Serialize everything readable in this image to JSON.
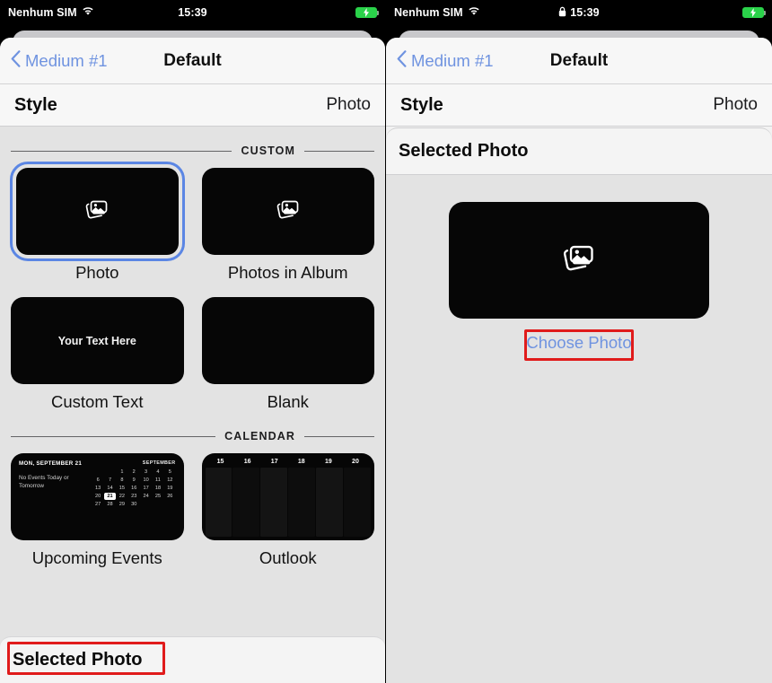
{
  "left_phone": {
    "status_bar": {
      "carrier": "Nenhum SIM",
      "wifi_icon": "wifi-icon",
      "time": "15:39",
      "battery_icon": "battery-charging-icon"
    },
    "nav": {
      "back_icon": "chevron-left-icon",
      "back_label": "Medium #1",
      "title": "Default"
    },
    "style_row": {
      "label": "Style",
      "value": "Photo"
    },
    "sections": [
      {
        "caption": "CUSTOM",
        "tiles": [
          {
            "label": "Photo",
            "icon": "photo-stack-icon",
            "selected": true
          },
          {
            "label": "Photos in Album",
            "icon": "photo-stack-icon",
            "selected": false
          },
          {
            "label": "Custom Text",
            "preview_text": "Your Text Here",
            "selected": false
          },
          {
            "label": "Blank",
            "selected": false
          }
        ]
      },
      {
        "caption": "CALENDAR",
        "tiles": [
          {
            "label": "Upcoming Events",
            "widget": "calendar"
          },
          {
            "label": "Outlook",
            "widget": "outlook"
          }
        ]
      }
    ],
    "calendar_widget": {
      "title": "MON, SEPTEMBER 21",
      "subtitle": "No Events Today or Tomorrow",
      "month": "SEPTEMBER",
      "days": [
        "",
        "",
        "1",
        "2",
        "3",
        "4",
        "5",
        "6",
        "7",
        "8",
        "9",
        "10",
        "11",
        "12",
        "13",
        "14",
        "15",
        "16",
        "17",
        "18",
        "19",
        "20",
        "21",
        "22",
        "23",
        "24",
        "25",
        "26",
        "27",
        "28",
        "29",
        "30"
      ],
      "today": "21"
    },
    "outlook_widget": {
      "columns": [
        "15",
        "16",
        "17",
        "18",
        "19",
        "20"
      ]
    },
    "bottom_sheet": {
      "title": "Selected Photo"
    }
  },
  "right_phone": {
    "status_bar": {
      "carrier": "Nenhum SIM",
      "wifi_icon": "wifi-icon",
      "lock_icon": "lock-icon",
      "time": "15:39",
      "battery_icon": "battery-charging-icon"
    },
    "nav": {
      "back_icon": "chevron-left-icon",
      "back_label": "Medium #1",
      "title": "Default"
    },
    "style_row": {
      "label": "Style",
      "value": "Photo"
    },
    "selected_photo_panel": {
      "title": "Selected Photo",
      "preview_icon": "photo-stack-icon",
      "choose_label": "Choose Photo"
    }
  },
  "annotations": {
    "highlight_color": "#e01b1b",
    "boxes": [
      "Selected Photo",
      "Choose Photo"
    ]
  },
  "colors": {
    "accent_blue": "#6f93e0",
    "selection_blue": "#5b86e4",
    "annotation_red": "#e01b1b",
    "sheet_bg": "#f2f2f2",
    "content_bg": "#e3e3e3",
    "tile_black": "#060606"
  }
}
